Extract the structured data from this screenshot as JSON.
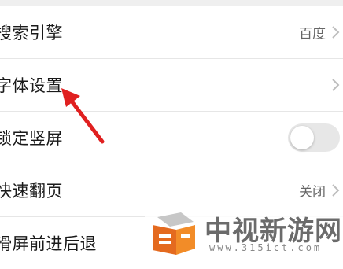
{
  "settings": {
    "rows": [
      {
        "label": "搜索引擎",
        "value": "百度"
      },
      {
        "label": "字体设置",
        "value": ""
      },
      {
        "label": "锁定竖屏",
        "toggle": false
      },
      {
        "label": "快速翻页",
        "value": "关闭"
      },
      {
        "label": "滑屏前进后退",
        "value": ""
      }
    ]
  },
  "annotation": {
    "arrow_color": "#e02020"
  },
  "watermark": {
    "title": "中视新游网",
    "url": "www.315ict.com"
  }
}
